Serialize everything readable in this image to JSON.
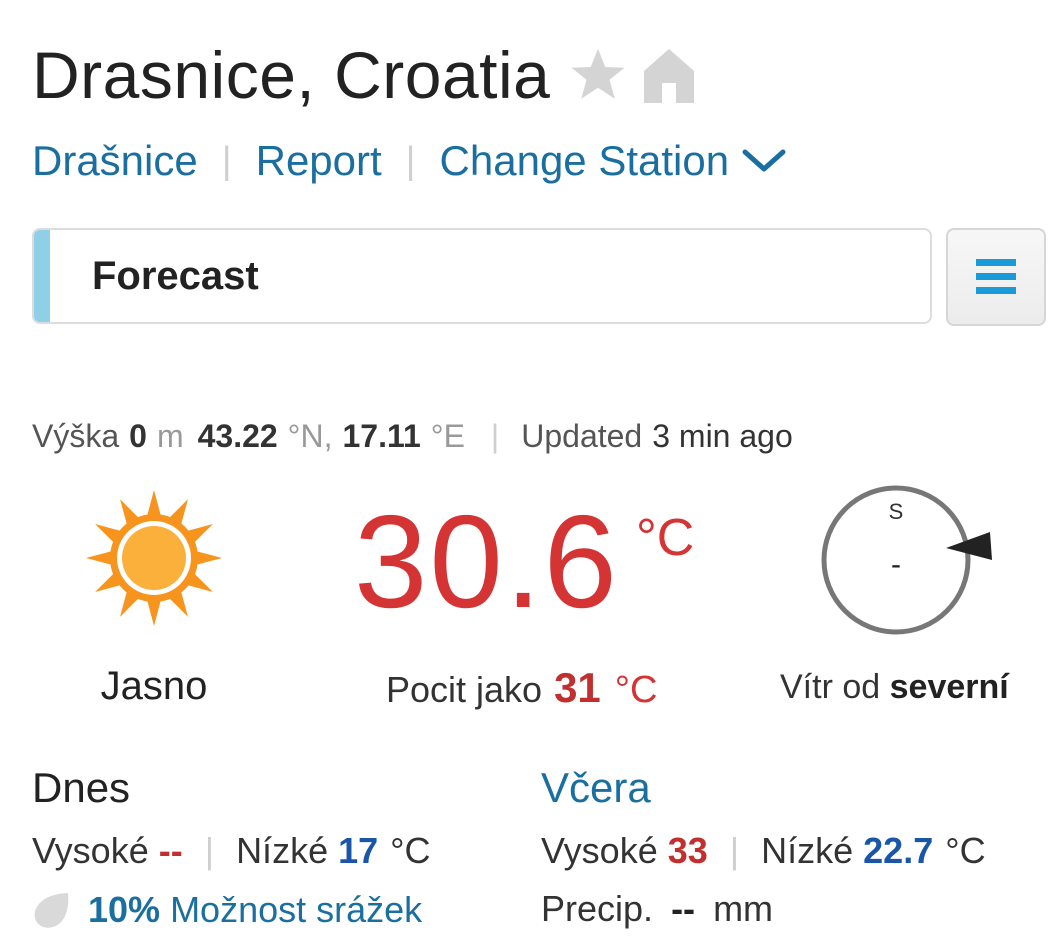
{
  "header": {
    "title": "Drasnice, Croatia",
    "favorite_icon": "star-icon",
    "home_icon": "home-icon"
  },
  "nav": {
    "station_link": "Drašnice",
    "report_link": "Report",
    "change_station": "Change Station",
    "separator": "|"
  },
  "forecast_bar": {
    "label": "Forecast",
    "accent_color": "#8fd0e6",
    "menu_icon": "hamburger-menu-icon",
    "menu_color": "#1a9ad6"
  },
  "meta": {
    "elevation_label": "Výška",
    "elevation_value": "0",
    "elevation_unit": "m",
    "lat_value": "43.22",
    "lat_unit": "°N,",
    "lon_value": "17.11",
    "lon_unit": "°E",
    "updated_label": "Updated",
    "updated_value": "3 min ago"
  },
  "current": {
    "condition_icon": "sun-icon",
    "condition": "Jasno",
    "temperature": "30.6",
    "temperature_unit": "°C",
    "feels_label": "Pocit jako",
    "feels_value": "31",
    "feels_unit": "°C",
    "compass_north": "S",
    "wind_speed": "-",
    "wind_label": "Vítr od",
    "wind_direction": "severní",
    "accent_red": "#d43434"
  },
  "today": {
    "title": "Dnes",
    "high_label": "Vysoké",
    "high_value": "--",
    "low_label": "Nízké",
    "low_value": "17",
    "unit": "°C",
    "precip_icon": "raindrop-icon",
    "precip_pct": "10%",
    "precip_label": "Možnost srážek"
  },
  "yesterday": {
    "title": "Včera",
    "high_label": "Vysoké",
    "high_value": "33",
    "low_label": "Nízké",
    "low_value": "22.7",
    "unit": "°C",
    "precip_label": "Precip.",
    "precip_value": "--",
    "precip_unit": "mm"
  }
}
